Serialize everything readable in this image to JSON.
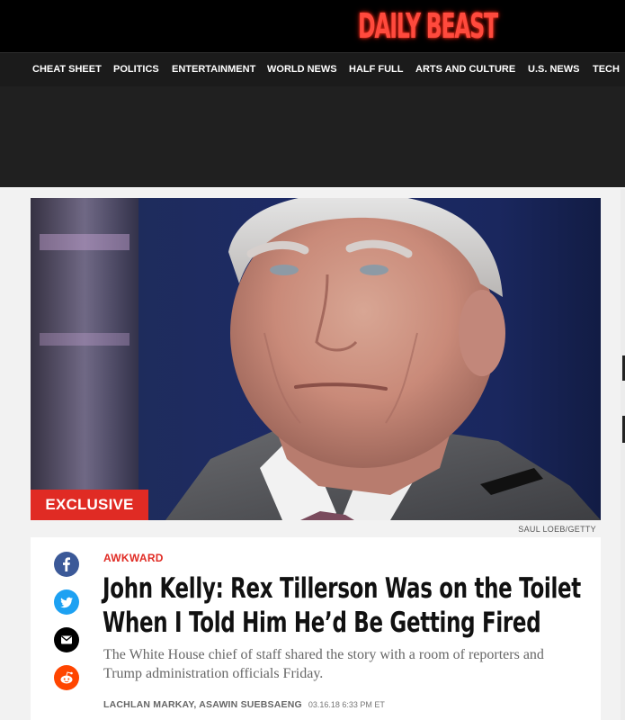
{
  "brand": {
    "logo_text": "DAILY BEAST",
    "accent": "#e02b24"
  },
  "nav": {
    "items": [
      {
        "label": "CHEAT SHEET"
      },
      {
        "label": "POLITICS"
      },
      {
        "label": "ENTERTAINMENT"
      },
      {
        "label": "WORLD NEWS"
      },
      {
        "label": "HALF FULL"
      },
      {
        "label": "ARTS AND CULTURE"
      },
      {
        "label": "U.S. NEWS"
      },
      {
        "label": "TECH"
      }
    ]
  },
  "hero": {
    "badge": "EXCLUSIVE",
    "photo_credit": "SAUL LOEB/GETTY"
  },
  "share": {
    "icons": [
      "facebook-icon",
      "twitter-icon",
      "email-icon",
      "reddit-icon"
    ]
  },
  "article": {
    "kicker": "AWKWARD",
    "headline_line1": "John Kelly: Rex Tillerson Was on the Toilet",
    "headline_line2": "When I Told Him He’d Be Getting Fired",
    "dek": "The White House chief of staff shared the story with a room of reporters and Trump administration officials Friday.",
    "authors": "LACHLAN MARKAY, ASAWIN SUEBSAENG",
    "timestamp": "03.16.18 6:33 PM ET"
  }
}
